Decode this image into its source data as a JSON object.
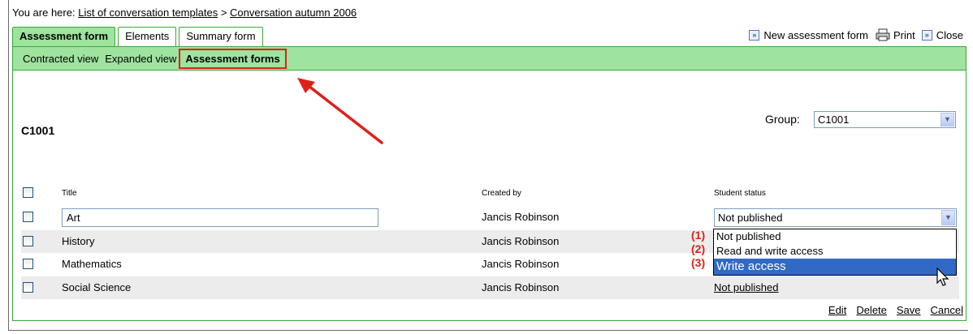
{
  "breadcrumb": {
    "prefix": "You are here:",
    "link1": "List of conversation templates",
    "separator": ">",
    "link2": "Conversation autumn 2006"
  },
  "tabs": [
    {
      "label": "Assessment form",
      "active": true
    },
    {
      "label": "Elements",
      "active": false
    },
    {
      "label": "Summary form",
      "active": false
    }
  ],
  "top_actions": {
    "new_label": "New assessment form",
    "print_label": "Print",
    "close_label": "Close"
  },
  "subnav": {
    "contracted": "Contracted view",
    "expanded": "Expanded view",
    "assessment_forms": "Assessment forms"
  },
  "group": {
    "title": "C1001",
    "label": "Group:",
    "selected": "C1001"
  },
  "table": {
    "headers": {
      "title": "Title",
      "created_by": "Created by",
      "student_status": "Student status"
    },
    "rows": [
      {
        "title": "Art",
        "created_by": "Jancis Robinson",
        "status": "Not published"
      },
      {
        "title": "History",
        "created_by": "Jancis Robinson",
        "status": ""
      },
      {
        "title": "Mathematics",
        "created_by": "Jancis Robinson",
        "status": ""
      },
      {
        "title": "Social Science",
        "created_by": "Jancis Robinson",
        "status": "Not published"
      }
    ]
  },
  "dropdown": {
    "options": [
      "Not published",
      "Read and write access",
      "Write access"
    ],
    "selected_index": 2,
    "markers": [
      "(1)",
      "(2)",
      "(3)"
    ]
  },
  "bottom_actions": {
    "edit": "Edit",
    "delete": "Delete",
    "save": "Save",
    "cancel": "Cancel"
  },
  "colors": {
    "tab_green": "#9ee39e",
    "border_green": "#3ca83c",
    "highlight_red": "#e0201a",
    "selection_blue": "#316ac5"
  }
}
